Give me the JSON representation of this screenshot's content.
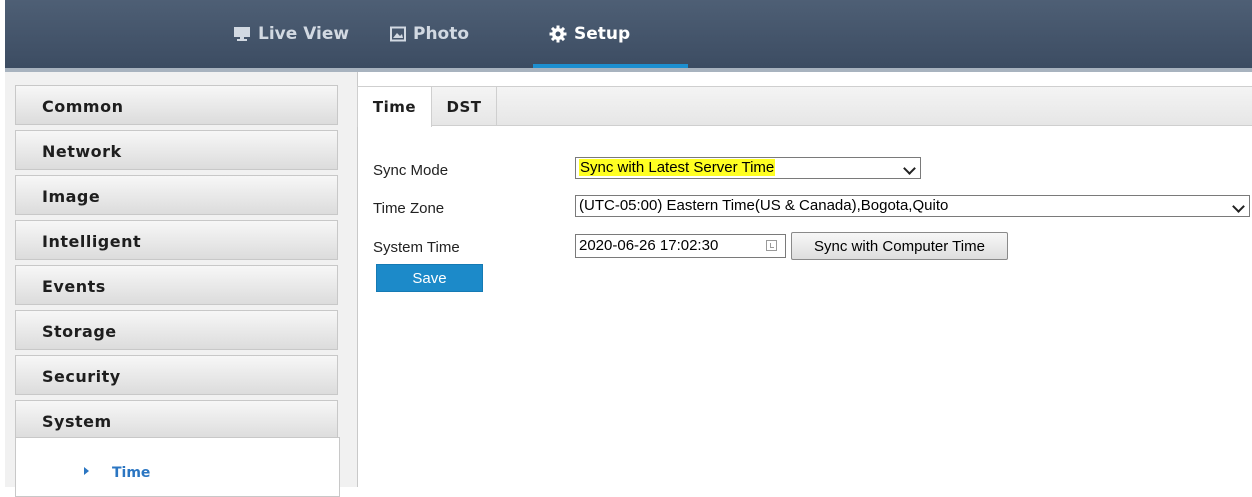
{
  "nav": {
    "items": [
      {
        "label": "Live View",
        "icon": "monitor-icon"
      },
      {
        "label": "Photo",
        "icon": "image-icon"
      },
      {
        "label": "Setup",
        "icon": "gear-icon",
        "active": true
      }
    ]
  },
  "sidebar": {
    "items": [
      {
        "label": "Common"
      },
      {
        "label": "Network"
      },
      {
        "label": "Image"
      },
      {
        "label": "Intelligent"
      },
      {
        "label": "Events"
      },
      {
        "label": "Storage"
      },
      {
        "label": "Security"
      },
      {
        "label": "System",
        "expanded": true
      }
    ],
    "subitems": [
      {
        "label": "Time",
        "active": true
      }
    ]
  },
  "tabs": [
    {
      "label": "Time",
      "active": true
    },
    {
      "label": "DST",
      "active": false
    }
  ],
  "form": {
    "sync_mode": {
      "label": "Sync Mode",
      "value": "Sync with Latest Server Time"
    },
    "time_zone": {
      "label": "Time Zone",
      "value": "(UTC-05:00) Eastern Time(US & Canada),Bogota,Quito"
    },
    "system_time": {
      "label": "System Time",
      "value": "2020-06-26 17:02:30"
    },
    "sync_button": "Sync with Computer Time",
    "save_button": "Save"
  },
  "colors": {
    "accent": "#1d8fd0",
    "highlight": "#ffff22",
    "topbar": "#44546a",
    "save_button": "#1c8ac9"
  }
}
